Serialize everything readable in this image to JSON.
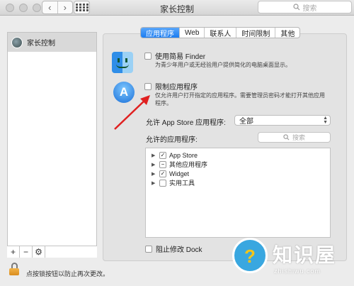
{
  "window": {
    "title": "家长控制"
  },
  "toolbar": {
    "back": "‹",
    "forward": "›",
    "search_placeholder": "搜索"
  },
  "sidebar": {
    "user": "家长控制",
    "add": "+",
    "remove": "−",
    "gear": "⚙"
  },
  "tabs": [
    {
      "label": "应用程序",
      "active": true
    },
    {
      "label": "Web",
      "active": false
    },
    {
      "label": "联系人",
      "active": false
    },
    {
      "label": "时间限制",
      "active": false
    },
    {
      "label": "其他",
      "active": false
    }
  ],
  "options": {
    "simple_finder": {
      "label": "使用简易 Finder",
      "desc": "为青少年用户或无经验用户提供简化的电脑桌面显示。",
      "checked": false
    },
    "limit_apps": {
      "label": "限制应用程序",
      "desc_line1": "仅允许用户打开指定的应用程序。需要管理员密码才能打开其他应用",
      "desc_line2": "程序。",
      "checked": false
    }
  },
  "app_store": {
    "label": "允许 App Store 应用程序:",
    "selected": "全部"
  },
  "allowed_apps": {
    "label": "允许的应用程序:",
    "search_placeholder": "搜索",
    "items": [
      {
        "name": "App Store",
        "check": "✓"
      },
      {
        "name": "其他应用程序",
        "check": "−"
      },
      {
        "name": "Widget",
        "check": "✓"
      },
      {
        "name": "实用工具",
        "check": ""
      }
    ]
  },
  "dock": {
    "label": "阻止修改 Dock",
    "checked": false
  },
  "lock": {
    "text": "点按锁按钮以防止再次更改。"
  },
  "watermark": {
    "title": "知识屋",
    "url": "zhishiwu.com"
  }
}
